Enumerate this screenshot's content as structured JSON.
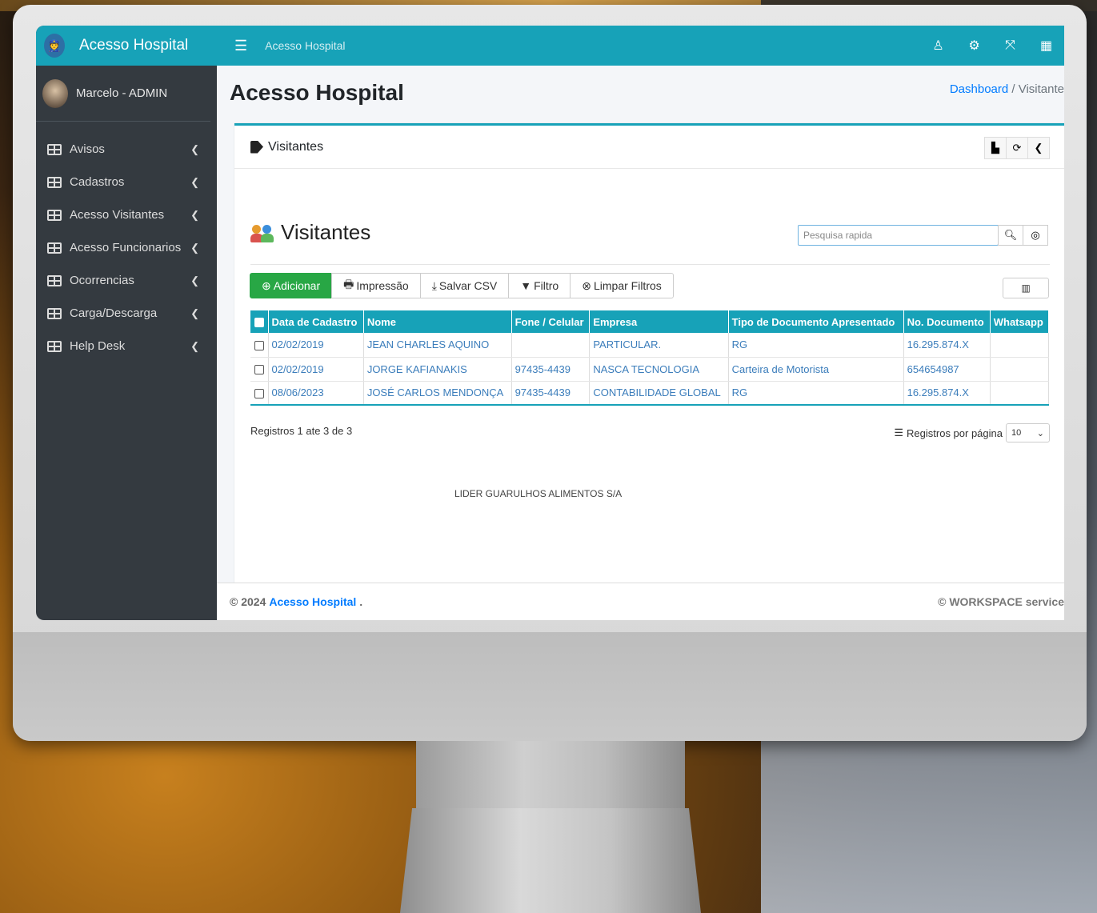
{
  "app": {
    "brand": "Acesso Hospital",
    "topbar_title": "Acesso Hospital",
    "page_title": "Acesso Hospital"
  },
  "user": {
    "name": "Marcelo - ADMIN"
  },
  "sidebar": {
    "items": [
      {
        "label": "Avisos"
      },
      {
        "label": "Cadastros"
      },
      {
        "label": "Acesso Visitantes"
      },
      {
        "label": "Acesso Funcionarios"
      },
      {
        "label": "Ocorrencias"
      },
      {
        "label": "Carga/Descarga"
      },
      {
        "label": "Help Desk"
      }
    ]
  },
  "breadcrumb": {
    "home": "Dashboard",
    "separator": "/",
    "current": "Visitante"
  },
  "card": {
    "header": "Visitantes",
    "section_title": "Visitantes"
  },
  "search": {
    "placeholder": "Pesquisa rapida"
  },
  "toolbar": {
    "add": "Adicionar",
    "print": "Impressão",
    "csv": "Salvar CSV",
    "filter": "Filtro",
    "clear": "Limpar Filtros"
  },
  "table": {
    "headers": [
      "Data de Cadastro",
      "Nome",
      "Fone / Celular",
      "Empresa",
      "Tipo de Documento Apresentado",
      "No. Documento",
      "Whatsapp"
    ],
    "rows": [
      {
        "date": "02/02/2019",
        "name": "JEAN CHARLES AQUINO",
        "phone": "",
        "company": "PARTICULAR.",
        "doc_type": "RG",
        "doc_no": "16.295.874.X",
        "whatsapp": ""
      },
      {
        "date": "02/02/2019",
        "name": "JORGE KAFIANAKIS",
        "phone": "97435-4439",
        "company": "NASCA TECNOLOGIA",
        "doc_type": "Carteira de Motorista",
        "doc_no": "654654987",
        "whatsapp": ""
      },
      {
        "date": "08/06/2023",
        "name": "JOSÉ CARLOS MENDONÇA",
        "phone": "97435-4439",
        "company": "CONTABILIDADE GLOBAL",
        "doc_type": "RG",
        "doc_no": "16.295.874.X",
        "whatsapp": ""
      }
    ]
  },
  "pagination": {
    "records": "Registros 1 ate 3 de 3",
    "per_page_label": "Registros por página",
    "per_page_value": "10"
  },
  "company_footer": "LIDER GUARULHOS ALIMENTOS S/A",
  "footer": {
    "copyright": "© 2024",
    "brand": "Acesso Hospital",
    "dot": ".",
    "right": "© WORKSPACE service"
  },
  "colors": {
    "accent": "#17a2b8",
    "sidebar": "#343a40",
    "success": "#28a745",
    "link": "#007bff"
  }
}
